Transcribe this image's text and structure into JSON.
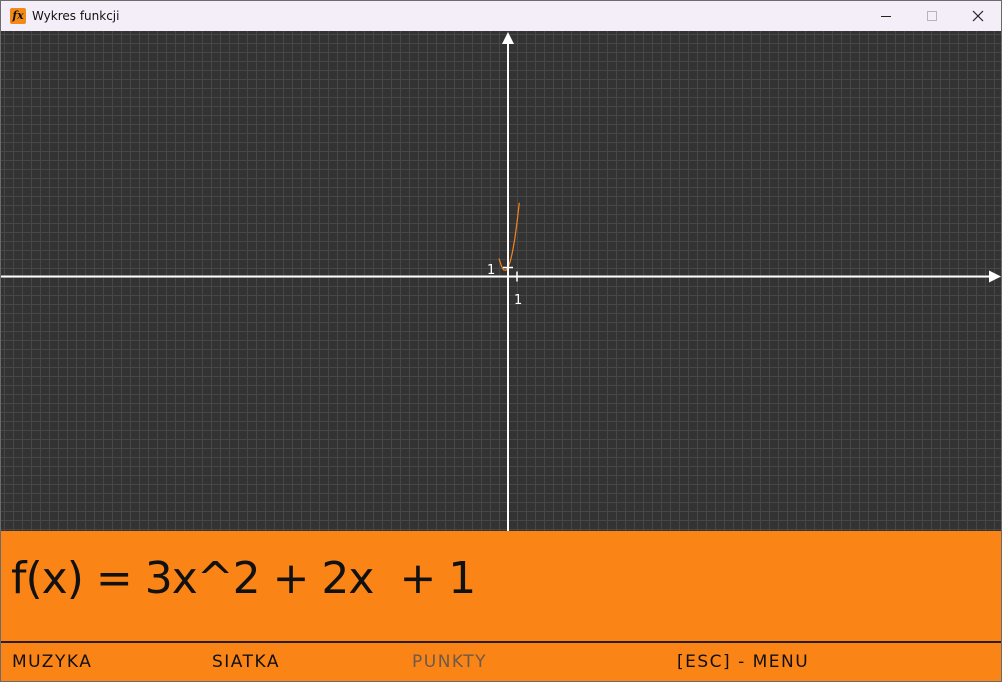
{
  "window": {
    "title": "Wykres funkcji",
    "icon": "fx-icon",
    "buttons": [
      "minimize-icon",
      "maximize-icon",
      "close-icon"
    ]
  },
  "graph": {
    "x_tick_label": "1",
    "y_tick_label": "1",
    "function_color": "#f7841c",
    "axis_color": "#ffffff",
    "grid_color": "#474747",
    "background_color": "#333333"
  },
  "chart_data": {
    "type": "line",
    "function": "3x^2 + 2x + 1",
    "x": [
      -1.0,
      -0.75,
      -0.5,
      -0.25,
      0.0,
      0.25,
      0.5,
      0.75,
      1.0,
      1.25
    ],
    "y": [
      2.0,
      1.1875,
      0.75,
      0.6875,
      1.0,
      1.6875,
      2.75,
      4.1875,
      6.0,
      8.1875
    ],
    "xlabel": "",
    "ylabel": "",
    "x_tick_labels": [
      "1"
    ],
    "y_tick_labels": [
      "1"
    ],
    "grid": true
  },
  "formula": {
    "text": "f(x) = 3x^2 + 2x  + 1"
  },
  "menu": {
    "muzyka": "MUZYKA",
    "siatka": "SIATKA",
    "punkty": "PUNKTY",
    "esc_menu": "[ESC] - MENU"
  },
  "colors": {
    "accent": "#fb8417",
    "titlebar": "#f3eef7",
    "disabled_text": "#6e5a48"
  }
}
